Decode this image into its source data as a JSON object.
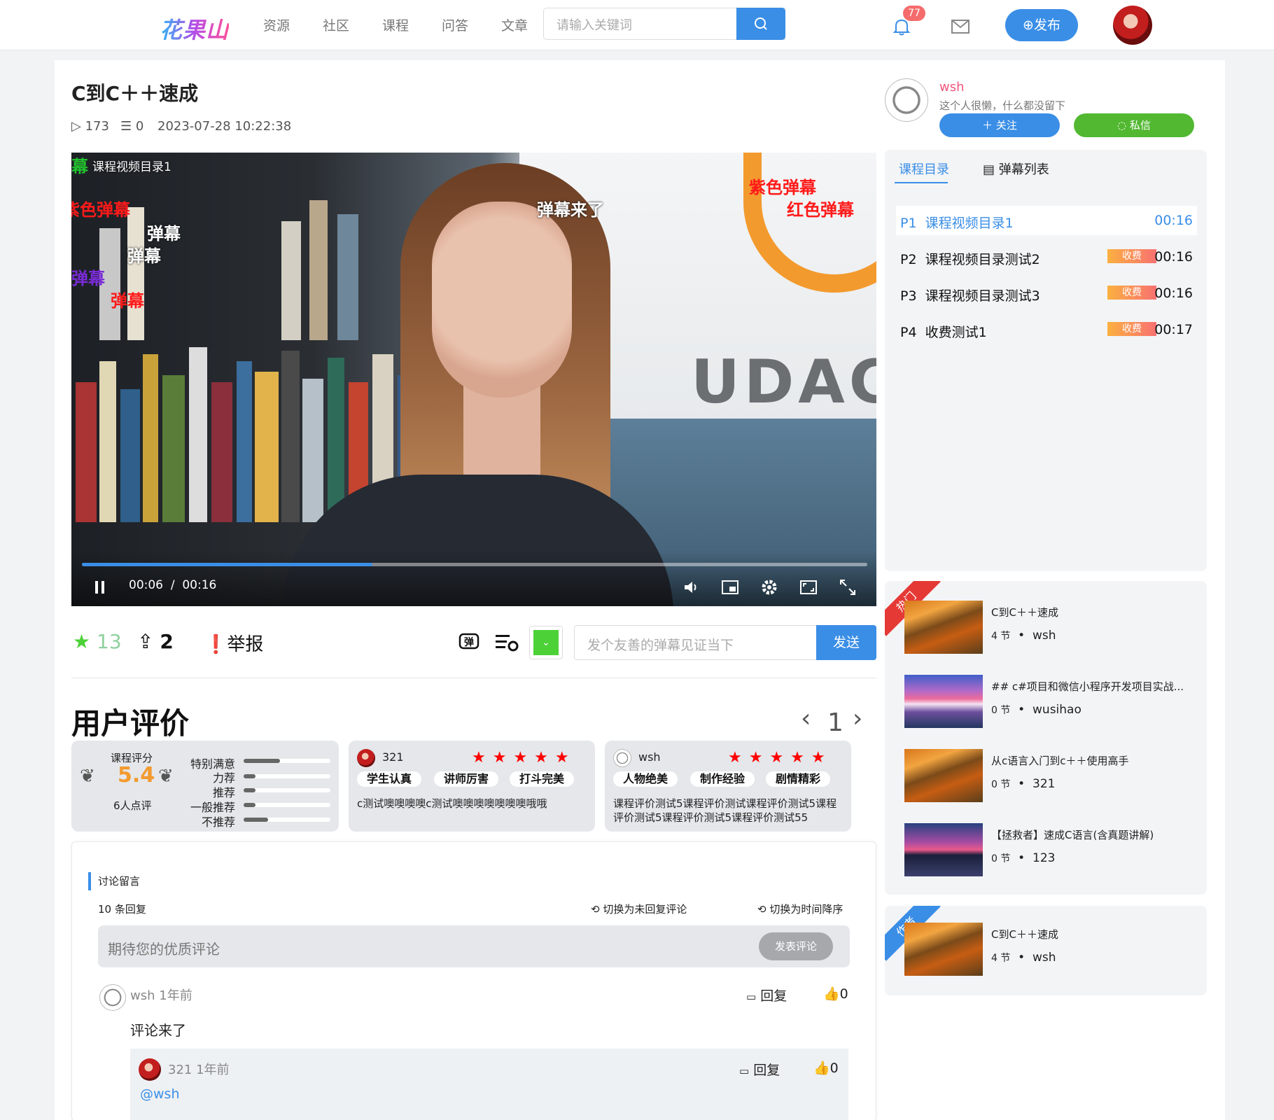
{
  "header": {
    "logo": "花果山",
    "nav": [
      "资源",
      "社区",
      "课程",
      "问答",
      "文章"
    ],
    "search_placeholder": "请输入关键词",
    "notification_count": "77",
    "publish_label": "发布"
  },
  "course": {
    "title": "C到C＋＋速成",
    "views": "173",
    "comments": "0",
    "datetime": "2023-07-28 10:22:38"
  },
  "video": {
    "overlay_title": "课程视频目录1",
    "current_time": "00:06",
    "separator": "/",
    "duration": "00:16",
    "progress": 0.37,
    "brand_text": "UDAC",
    "danmaku": [
      {
        "text": "幕",
        "color": "#22c22e"
      },
      {
        "text": "紫色弹幕",
        "color": "#ff1a1a"
      },
      {
        "text": "红色弹幕",
        "color": "#ff1a1a"
      },
      {
        "text": "弹幕来了",
        "color": "#ffffff"
      },
      {
        "text": "紫色弹幕",
        "color": "#ff1a1a"
      },
      {
        "text": "弹幕",
        "color": "#ffffff"
      },
      {
        "text": "弹幕",
        "color": "#ffffff"
      },
      {
        "text": "弹幕",
        "color": "#7a2bd6"
      },
      {
        "text": "弹幕",
        "color": "#ff1a1a"
      }
    ]
  },
  "actions": {
    "stars": "13",
    "shares": "2",
    "report": "举报",
    "danmaku_placeholder": "发个友善的弹幕见证当下",
    "send_label": "发送",
    "danmaku_color": "#4cd137"
  },
  "reviews": {
    "heading": "用户评价",
    "page": "1",
    "summary": {
      "label": "课程评分",
      "score": "5.4",
      "count_text": "6人点评",
      "bars": [
        {
          "label": "特别满意",
          "fraction": 0.42
        },
        {
          "label": "力荐",
          "fraction": 0.14
        },
        {
          "label": "推荐",
          "fraction": 0.14
        },
        {
          "label": "一般推荐",
          "fraction": 0.14
        },
        {
          "label": "不推荐",
          "fraction": 0.28
        }
      ]
    },
    "items": [
      {
        "user": "321",
        "stars": "★★★★★",
        "tags": [
          "学生认真",
          "讲师厉害",
          "打斗完美"
        ],
        "text": "c测试噢噢噢噢c测试噢噢噢噢噢噢噢哦哦"
      },
      {
        "user": "wsh",
        "stars": "★★★★★",
        "tags": [
          "人物绝美",
          "制作经验",
          "剧情精彩"
        ],
        "text": "课程评价测试5课程评价测试课程评价测试5课程评价测试5课程评价测试5课程评价测试55"
      }
    ]
  },
  "discussion": {
    "section_title": "讨论留言",
    "reply_count": "10 条回复",
    "toggle_unreplied": "切换为未回复评论",
    "toggle_time": "切换为时间降序",
    "input_placeholder": "期待您的优质评论",
    "post_label": "发表评论",
    "comments": [
      {
        "user": "wsh",
        "time": "1年前",
        "reply": "回复",
        "likes": "0",
        "text": "评论来了"
      },
      {
        "user": "321",
        "time": "1年前",
        "reply": "回复",
        "likes": "0",
        "text": "@wsh"
      }
    ]
  },
  "author": {
    "name": "wsh",
    "bio": "这个人很懒，什么都没留下",
    "follow_label": "关注",
    "message_label": "私信"
  },
  "catalog": {
    "tabs": [
      "课程目录",
      "弹幕列表"
    ],
    "episodes": [
      {
        "code": "P1",
        "title": "课程视频目录1",
        "fee": "",
        "duration": "00:16"
      },
      {
        "code": "P2",
        "title": "课程视频目录测试2",
        "fee": "收费",
        "duration": "00:16"
      },
      {
        "code": "P3",
        "title": "课程视频目录测试3",
        "fee": "收费",
        "duration": "00:16"
      },
      {
        "code": "P4",
        "title": "收费测试1",
        "fee": "收费",
        "duration": "00:17"
      }
    ]
  },
  "hot": {
    "ribbon": "热门",
    "items": [
      {
        "title": "C到C＋＋速成",
        "lessons": "4 节",
        "author": "wsh"
      },
      {
        "title": "## c#项目和微信小程序开发项目实战...",
        "lessons": "0 节",
        "author": "wusihao"
      },
      {
        "title": "从c语言入门到c＋＋使用高手",
        "lessons": "0 节",
        "author": "321"
      },
      {
        "title": "【拯救者】速成C语言(含真题讲解)",
        "lessons": "0 节",
        "author": "123"
      }
    ]
  },
  "author_courses": {
    "ribbon": "作者",
    "items": [
      {
        "title": "C到C＋＋速成",
        "lessons": "4 节",
        "author": "wsh"
      }
    ]
  }
}
